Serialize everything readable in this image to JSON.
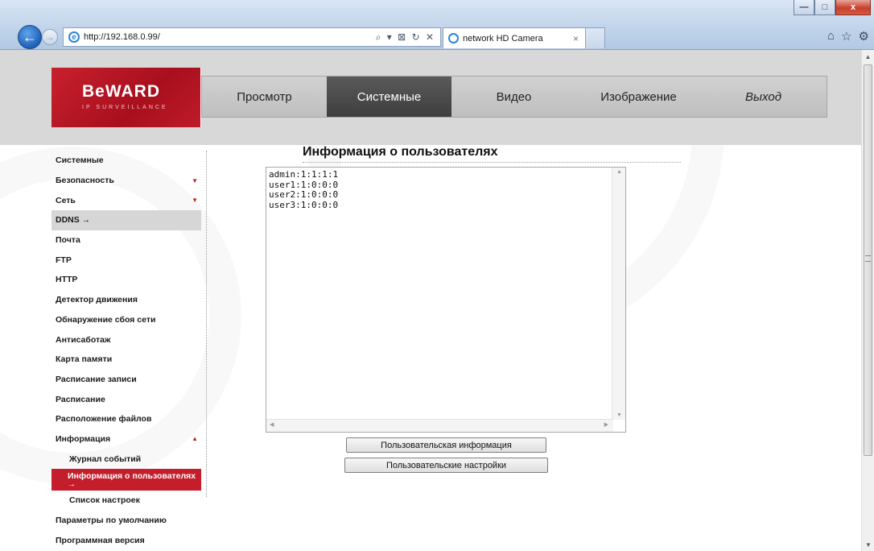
{
  "browser": {
    "url": "http://192.168.0.99/",
    "address_tools": "⌕ ▾ ⊠ ↻ ✕",
    "tab_title": "network HD Camera",
    "tab_close": "×",
    "win_minimize": "—",
    "win_maximize": "□",
    "win_close": "x",
    "back_glyph": "←",
    "forward_glyph": "→",
    "home_glyph": "⌂",
    "favorites_glyph": "☆",
    "tools_glyph": "⚙"
  },
  "header": {
    "logo_text": "BeWARD",
    "logo_sub": "IP SURVEILLANCE",
    "nav": [
      {
        "label": "Просмотр"
      },
      {
        "label": "Системные"
      },
      {
        "label": "Видео"
      },
      {
        "label": "Изображение"
      },
      {
        "label": "Выход"
      }
    ]
  },
  "sidebar": {
    "items": [
      {
        "label": "Системные"
      },
      {
        "label": "Безопасность",
        "indicator": "▼"
      },
      {
        "label": "Сеть",
        "indicator": "▼"
      },
      {
        "label": "DDNS →"
      },
      {
        "label": "Почта"
      },
      {
        "label": "FTP"
      },
      {
        "label": "HTTP"
      },
      {
        "label": "Детектор движения"
      },
      {
        "label": "Обнаружение сбоя сети"
      },
      {
        "label": "Антисаботаж"
      },
      {
        "label": "Карта памяти"
      },
      {
        "label": "Расписание записи"
      },
      {
        "label": "Расписание"
      },
      {
        "label": "Расположение файлов"
      },
      {
        "label": "Информация",
        "indicator": "▲"
      },
      {
        "label": "Журнал событий"
      },
      {
        "label": "Информация о пользователях",
        "arrow": "→"
      },
      {
        "label": "Список настроек"
      },
      {
        "label": "Параметры по умолчанию"
      },
      {
        "label": "Программная версия"
      }
    ]
  },
  "content": {
    "title": "Информация о пользователях",
    "user_lines": [
      "admin:1:1:1:1",
      "user1:1:0:0:0",
      "user2:1:0:0:0",
      "user3:1:0:0:0"
    ],
    "userinfo_button": "Пользовательская информация",
    "usersettings_button": "Пользовательские настройки"
  },
  "colors": {
    "brand_red": "#c41e2d",
    "nav_active": "#4a4a4a",
    "header_band": "#d8d8d8"
  }
}
